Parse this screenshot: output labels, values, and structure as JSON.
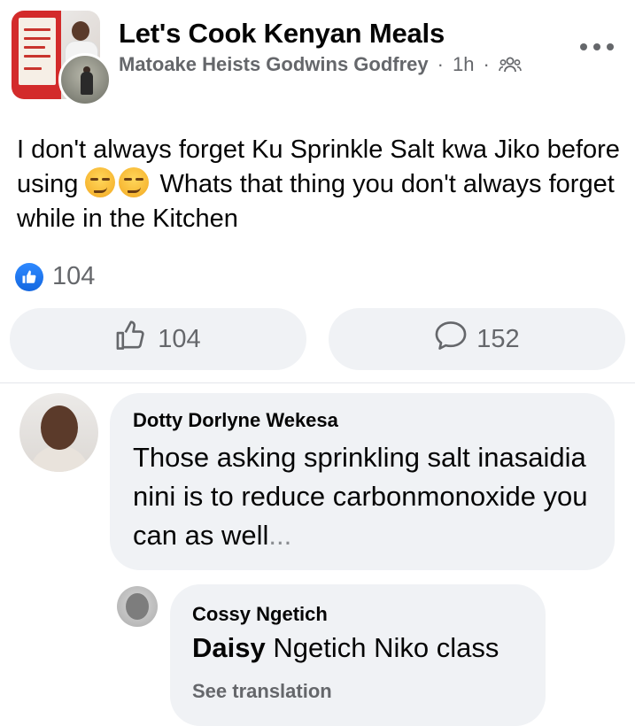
{
  "post": {
    "group_name": "Let's Cook Kenyan Meals",
    "author": "Matoake Heists Godwins Godfrey",
    "separator": "·",
    "time": "1h",
    "text_part1": "I don't always forget Ku Sprinkle Salt kwa Jiko before using",
    "text_part2": "Whats that thing you don't always forget while in the Kitchen",
    "reaction_count": "104",
    "like_count": "104",
    "comment_count": "152"
  },
  "comments": [
    {
      "author": "Dotty Dorlyne Wekesa",
      "text": "Those asking sprinkling salt inasaidia nini is to reduce carbonmonoxide you can as well",
      "ellipsis": "..."
    },
    {
      "author": "Cossy Ngetich",
      "mention": "Daisy",
      "text": " Ngetich Niko class",
      "see_translation": "See translation"
    }
  ],
  "icons": {
    "more": "more-horizontal-icon",
    "audience": "group-members-icon",
    "like": "thumbs-up-icon",
    "comment": "speech-bubble-icon",
    "emoji": "smirk-emoji-icon"
  },
  "colors": {
    "brand_blue": "#1877f2",
    "secondary_text": "#65676b",
    "bubble_bg": "#f0f2f5"
  }
}
